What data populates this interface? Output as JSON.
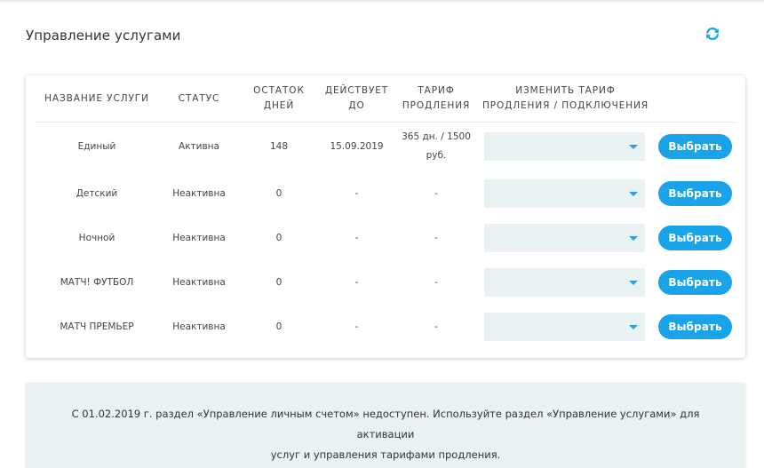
{
  "page": {
    "title": "Управление услугами"
  },
  "icons": {
    "refresh": "refresh-icon",
    "dropdown": "chevron-down-icon"
  },
  "colors": {
    "accent": "#1aa3e8",
    "select_bg": "#e9f1f3",
    "notice_bg": "#e9f1f3"
  },
  "table": {
    "headers": {
      "name": "НАЗВАНИЕ УСЛУГИ",
      "status": "СТАТУС",
      "days_left_1": "ОСТАТОК",
      "days_left_2": "ДНЕЙ",
      "valid_1": "ДЕЙСТВУЕТ",
      "valid_2": "ДО",
      "tariff_1": "ТАРИФ",
      "tariff_2": "ПРОДЛЕНИЯ",
      "change_1": "ИЗМЕНИТЬ ТАРИФ",
      "change_2": "ПРОДЛЕНИЯ / ПОДКЛЮЧЕНИЯ"
    },
    "rows": [
      {
        "name": "Единый",
        "status": "Активна",
        "days_left": "148",
        "valid_until": "15.09.2019",
        "tariff_1": "365 дн. / 1500",
        "tariff_2": "руб.",
        "select_value": "",
        "button": "Выбрать"
      },
      {
        "name": "Детский",
        "status": "Неактивна",
        "days_left": "0",
        "valid_until": "-",
        "tariff_1": "-",
        "tariff_2": "",
        "select_value": "",
        "button": "Выбрать"
      },
      {
        "name": "Ночной",
        "status": "Неактивна",
        "days_left": "0",
        "valid_until": "-",
        "tariff_1": "-",
        "tariff_2": "",
        "select_value": "",
        "button": "Выбрать"
      },
      {
        "name": "МАТЧ! ФУТБОЛ",
        "status": "Неактивна",
        "days_left": "0",
        "valid_until": "-",
        "tariff_1": "-",
        "tariff_2": "",
        "select_value": "",
        "button": "Выбрать"
      },
      {
        "name": "МАТЧ ПРЕМЬЕР",
        "status": "Неактивна",
        "days_left": "0",
        "valid_until": "-",
        "tariff_1": "-",
        "tariff_2": "",
        "select_value": "",
        "button": "Выбрать"
      }
    ]
  },
  "notice": {
    "line1": "С 01.02.2019 г. раздел «Управление личным счетом» недоступен. Используйте раздел «Управление услугами» для активации",
    "line2": "услуг и управления тарифами продления."
  }
}
